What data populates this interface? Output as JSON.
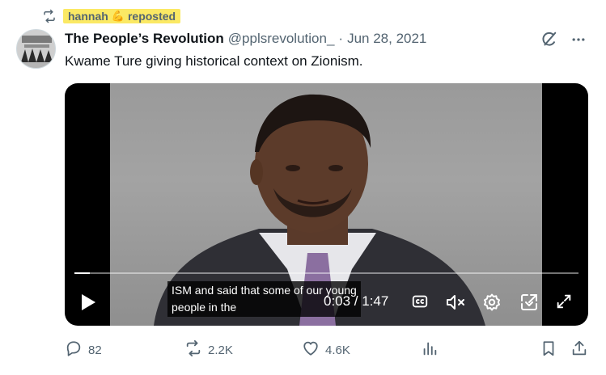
{
  "social_context": {
    "user": "hannah",
    "emoji": "💪",
    "action": "reposted"
  },
  "tweet": {
    "author_name": "The People’s Revolution",
    "handle": "@pplsrevolution_",
    "separator": "·",
    "date": "Jun 28, 2021",
    "text": "Kwame Ture giving historical context on Zionism."
  },
  "video": {
    "progress_fraction": 0.03,
    "caption_lines": [
      "ISM and said that some of our young",
      "people in the"
    ],
    "time": "0:03 / 1:47"
  },
  "actions": {
    "replies": "82",
    "reposts": "2.2K",
    "likes": "4.6K"
  },
  "icons": {
    "repost": "repost-icon",
    "grok": "grok-icon",
    "more": "more-icon",
    "play": "play-icon",
    "captions": "captions-icon",
    "mute": "mute-icon",
    "settings": "settings-icon",
    "popout": "popout-icon",
    "fullscreen": "fullscreen-icon",
    "reply": "reply-icon",
    "like": "like-icon",
    "views": "views-icon",
    "bookmark": "bookmark-icon",
    "share": "share-icon"
  }
}
